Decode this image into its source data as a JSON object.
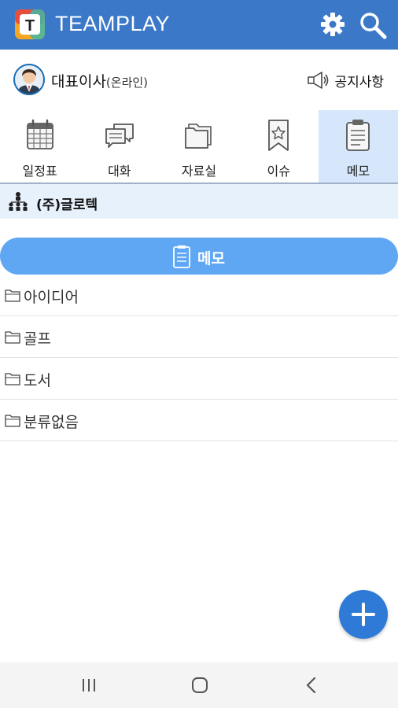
{
  "app": {
    "title": "TEAMPLAY",
    "logo_letter": "T"
  },
  "header": {
    "settings_icon": "gear-icon",
    "search_icon": "search-icon"
  },
  "user": {
    "name": "대표이사",
    "status": "(온라인)"
  },
  "notice": {
    "label": "공지사항",
    "icon": "megaphone-icon"
  },
  "tabs": [
    {
      "label": "일정표",
      "icon": "calendar-icon",
      "active": false
    },
    {
      "label": "대화",
      "icon": "chat-icon",
      "active": false
    },
    {
      "label": "자료실",
      "icon": "folder-icon",
      "active": false
    },
    {
      "label": "이슈",
      "icon": "bookmark-star-icon",
      "active": false
    },
    {
      "label": "메모",
      "icon": "clipboard-icon",
      "active": true
    }
  ],
  "org": {
    "name": "(주)글로텍",
    "icon": "org-chart-icon"
  },
  "memo_banner": {
    "label": "메모",
    "icon": "clipboard-icon"
  },
  "folders": [
    {
      "label": "아이디어"
    },
    {
      "label": "골프"
    },
    {
      "label": "도서"
    },
    {
      "label": "분류없음"
    }
  ],
  "fab": {
    "icon": "plus-icon"
  },
  "system_nav": {
    "recent": "recent-apps-icon",
    "home": "home-icon",
    "back": "back-icon"
  },
  "colors": {
    "appbar": "#3b78c8",
    "active_tab": "#d6e7fb",
    "banner": "#5fa6f3",
    "fab": "#2f7ad6"
  }
}
